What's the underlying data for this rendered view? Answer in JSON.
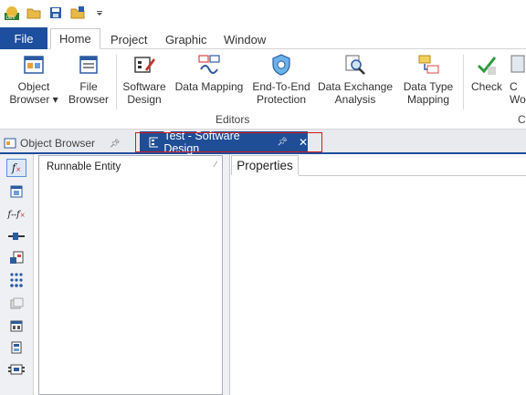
{
  "quick_access": {
    "icons": [
      "dev-logo-icon",
      "open-folder-icon",
      "save-icon",
      "save-all-icon",
      "customize-dropdown-icon"
    ]
  },
  "ribbon_tabs": {
    "file": "File",
    "home": "Home",
    "project": "Project",
    "graphic": "Graphic",
    "window": "Window"
  },
  "ribbon": {
    "object_browser": {
      "line1": "Object",
      "line2": "Browser ▾"
    },
    "file_browser": {
      "line1": "File",
      "line2": "Browser"
    },
    "software_design": {
      "line1": "Software",
      "line2": "Design"
    },
    "data_mapping": {
      "line1": "Data Mapping",
      "line2": ""
    },
    "e2e_protection": {
      "line1": "End-To-End",
      "line2": "Protection"
    },
    "data_exchange": {
      "line1": "Data Exchange",
      "line2": "Analysis"
    },
    "data_type_mapping": {
      "line1": "Data Type",
      "line2": "Mapping"
    },
    "check": {
      "line1": "Check",
      "line2": ""
    },
    "cut_off_1": {
      "line1": "C",
      "line2": "Wo"
    },
    "editors_group": "Editors",
    "cut_off_group": "C"
  },
  "doc_tabs": {
    "object_browser": "Object Browser",
    "active": "Test - Software Design"
  },
  "panels": {
    "runnable_title": "Runnable Entity",
    "properties_title": "Properties"
  },
  "colors": {
    "accent": "#1e4e9e",
    "highlight": "#d51a1a"
  }
}
